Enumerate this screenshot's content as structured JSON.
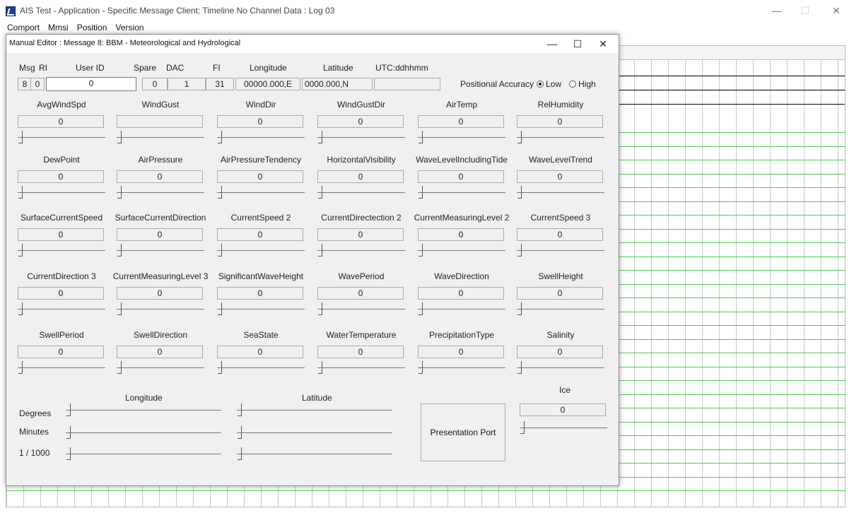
{
  "window": {
    "title": "AIS Test - Application - Specific Message Client: Timeline No Channel Data : Log 03",
    "minimize": "—",
    "maximize": "☐",
    "close": "✕"
  },
  "menu": [
    "Comport",
    "Mmsi",
    "Position",
    "Version"
  ],
  "dialog": {
    "title": "Manual Editor : Message 8: BBM - Meteorological and Hydrological",
    "minimize": "—",
    "maximize": "☐",
    "close": "✕"
  },
  "header": {
    "labels": [
      "Msg",
      "RI",
      "User ID",
      "Spare",
      "DAC",
      "FI",
      "Longitude",
      "Latitude",
      "UTC:ddhhmm"
    ],
    "values": {
      "msg": "8",
      "ri": "0",
      "user_id": "0",
      "spare": "0",
      "dac": "1",
      "fi": "31",
      "longitude": "00000.000,E",
      "latitude": "0000.000,N",
      "utc": ""
    },
    "positional_accuracy_label": "Positional Accuracy",
    "accuracy_options": [
      {
        "label": "Low",
        "selected": true
      },
      {
        "label": "High",
        "selected": false
      }
    ]
  },
  "params": [
    [
      {
        "label": "AvgWindSpd",
        "value": "0"
      },
      {
        "label": "WindGust",
        "value": ""
      },
      {
        "label": "WindDir",
        "value": "0"
      },
      {
        "label": "WindGustDir",
        "value": "0"
      },
      {
        "label": "AirTemp",
        "value": "0"
      },
      {
        "label": "RelHumidity",
        "value": "0"
      }
    ],
    [
      {
        "label": "DewPoint",
        "value": "0"
      },
      {
        "label": "AirPressure",
        "value": "0"
      },
      {
        "label": "AirPressureTendency",
        "value": "0"
      },
      {
        "label": "HorizontalVisibility",
        "value": "0"
      },
      {
        "label": "WaveLevelIncludingTide",
        "value": "0"
      },
      {
        "label": "WaveLevelTrend",
        "value": "0"
      }
    ],
    [
      {
        "label": "SurfaceCurrentSpeed",
        "value": "0"
      },
      {
        "label": "SurfaceCurrentDirection",
        "value": "0"
      },
      {
        "label": "CurrentSpeed 2",
        "value": "0"
      },
      {
        "label": "CurrentDirectection 2",
        "value": "0"
      },
      {
        "label": "CurrentMeasuringLevel 2",
        "value": "0"
      },
      {
        "label": "CurrentSpeed 3",
        "value": "0"
      }
    ],
    [
      {
        "label": "CurrentDirection 3",
        "value": "0"
      },
      {
        "label": "CurrentMeasuringLevel 3",
        "value": "0"
      },
      {
        "label": "SignificantWaveHeight",
        "value": "0"
      },
      {
        "label": "WavePeriod",
        "value": "0"
      },
      {
        "label": "WaveDirection",
        "value": "0"
      },
      {
        "label": "SwellHeight",
        "value": "0"
      }
    ],
    [
      {
        "label": "SwellPeriod",
        "value": "0"
      },
      {
        "label": "SwellDirection",
        "value": "0"
      },
      {
        "label": "SeaState",
        "value": "0"
      },
      {
        "label": "WaterTemperature",
        "value": "0"
      },
      {
        "label": "PrecipitationType",
        "value": "0"
      },
      {
        "label": "Salinity",
        "value": "0"
      }
    ]
  ],
  "position_sliders": {
    "longitude_label": "Longitude",
    "latitude_label": "Latitude",
    "rows": [
      "Degrees",
      "Minutes",
      "1 / 1000"
    ]
  },
  "ice": {
    "label": "Ice",
    "value": "0"
  },
  "presentation_button": "Presentation Port",
  "colors": {
    "dialog_bg": "#f0f0f0",
    "grid_green": "#4dcc4d",
    "app_icon": "#1f3f8f"
  }
}
